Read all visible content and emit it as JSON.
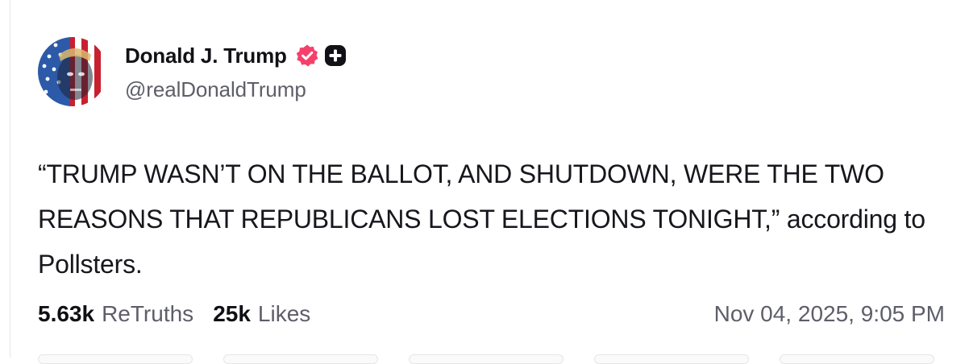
{
  "post": {
    "author": {
      "name": "Donald J. Trump",
      "handle": "@realDonaldTrump",
      "verified_icon": "verified-badge-icon",
      "plus_icon": "plus-badge-icon",
      "verified_color": "#f5406b"
    },
    "text": "“TRUMP WASN’T ON THE BALLOT, AND SHUTDOWN, WERE THE TWO REASONS THAT REPUBLICANS LOST ELECTIONS TONIGHT,” according to Pollsters.",
    "stats": {
      "retruths_count": "5.63k",
      "retruths_label": "ReTruths",
      "likes_count": "25k",
      "likes_label": "Likes"
    },
    "timestamp": "Nov 04, 2025, 9:05 PM"
  }
}
